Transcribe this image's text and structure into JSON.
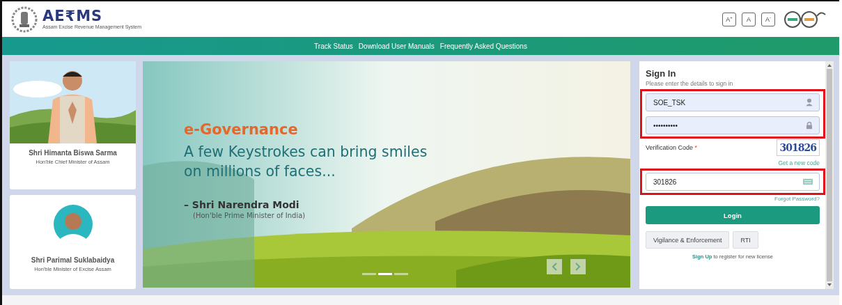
{
  "header": {
    "logo": {
      "title": "AE₹MS",
      "subtitle": "Assam Excise Revenue Management System"
    },
    "font_buttons": [
      "A$^{+}$",
      "A",
      "A$^{-}$"
    ]
  },
  "nav": {
    "links": [
      "Track Status",
      "Download User Manuals",
      "Frequently Asked Questions"
    ]
  },
  "leaders": [
    {
      "kind": "banner-photo",
      "name": "Shri Himanta Biswa Sarma",
      "role": "Hon'ble Chief Minister of Assam"
    },
    {
      "kind": "round-photo",
      "name": "Shri Parimal Suklabaidya",
      "role": "Hon'ble Minister of Excise Assam"
    }
  ],
  "banner": {
    "kicker": "e-Governance",
    "headline": "A few Keystrokes can bring smiles on millions of faces...",
    "quote_by": "– Shri Narendra Modi",
    "quote_role": "(Hon'ble Prime Minister of India)",
    "slides": [
      {
        "selected": false
      },
      {
        "selected": true
      },
      {
        "selected": false
      }
    ]
  },
  "signin": {
    "title": "Sign In",
    "subtitle": "Please enter the details to sign in",
    "credentials": {
      "highlighted": true,
      "username": "SOE_TSK",
      "password": "••••••••••"
    },
    "captcha_label": "Verification Code",
    "required_mark": "*",
    "captcha_text": "301826",
    "new_code_link": "Get a new code",
    "code_entry": {
      "highlighted": true,
      "value": "301826"
    },
    "forgot_link": "Forgot Password?",
    "login_button": "Login",
    "buttons": [
      "Vigilance & Enforcement",
      "RTI"
    ],
    "signup": {
      "link": "Sign Up",
      "text": "to register for new license"
    }
  }
}
